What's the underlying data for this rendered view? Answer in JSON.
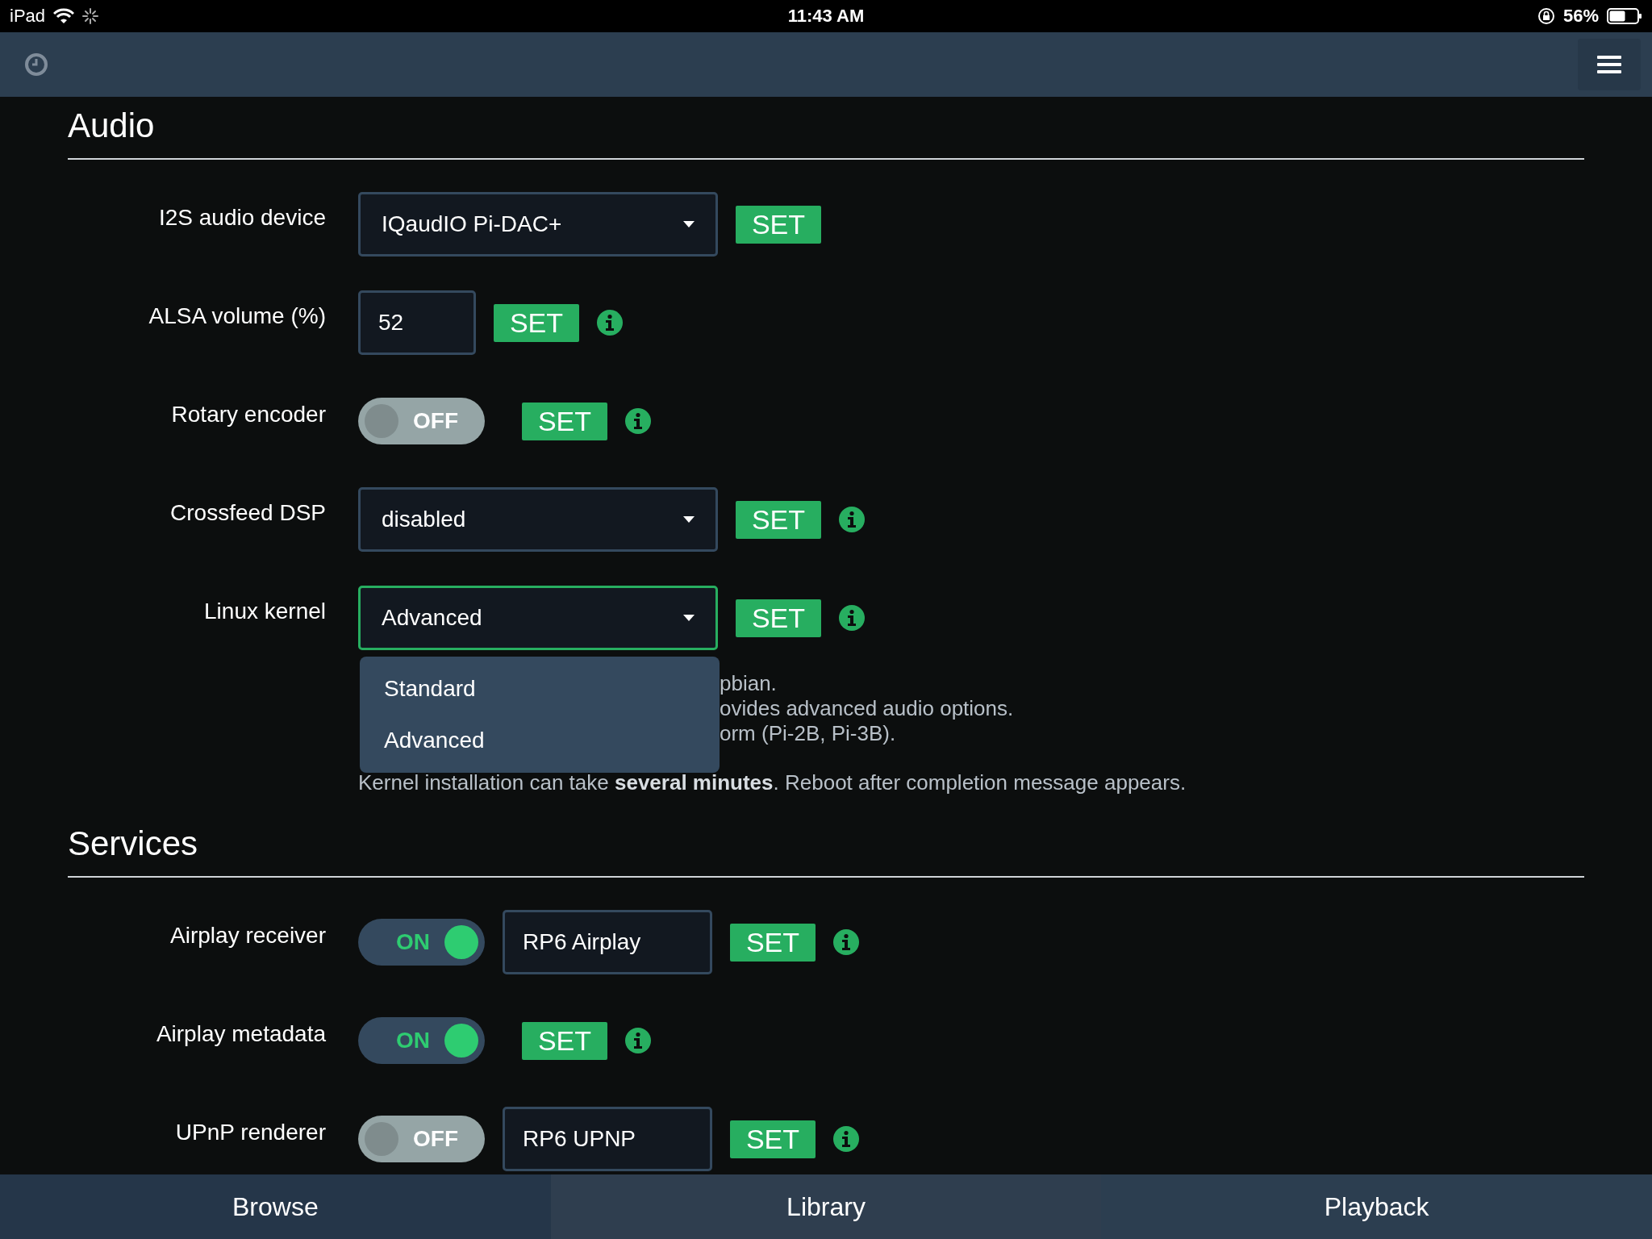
{
  "status_bar": {
    "device": "iPad",
    "time": "11:43 AM",
    "battery": "56%"
  },
  "sections": [
    {
      "title": "Audio",
      "rows": [
        {
          "label": "I2S audio device",
          "kind": "select",
          "value": "IQaudIO Pi-DAC+",
          "focused": false,
          "button": "SET",
          "info": false
        },
        {
          "label": "ALSA volume (%)",
          "kind": "number",
          "value": "52",
          "button": "SET",
          "info": true
        },
        {
          "label": "Rotary encoder",
          "kind": "toggle",
          "on": false,
          "on_text": "OFF",
          "button": "SET",
          "info": true
        },
        {
          "label": "Crossfeed DSP",
          "kind": "select",
          "value": "disabled",
          "focused": false,
          "button": "SET",
          "info": true
        },
        {
          "label": "Linux kernel",
          "kind": "select",
          "value": "Advanced",
          "focused": true,
          "button": "SET",
          "info": true,
          "expanded": true,
          "options": [
            {
              "label": "Standard"
            },
            {
              "label": "Advanced"
            }
          ],
          "help_fragments": [
            "pbian.",
            "ovides advanced audio options.",
            "orm (Pi-2B, Pi-3B)."
          ],
          "note": "Kernel installation can take **several minutes**. Reboot after completion message appears."
        }
      ]
    },
    {
      "title": "Services",
      "rows": [
        {
          "label": "Airplay receiver",
          "kind": "toggle",
          "on": true,
          "on_text": "ON",
          "name": "RP6 Airplay",
          "button": "SET",
          "info": true
        },
        {
          "label": "Airplay metadata",
          "kind": "toggle",
          "on": true,
          "on_text": "ON",
          "button": "SET",
          "info": true
        },
        {
          "label": "UPnP renderer",
          "kind": "toggle",
          "on": false,
          "on_text": "OFF",
          "name": "RP6 UPNP",
          "button": "SET",
          "info": true
        }
      ]
    }
  ],
  "nav_tabs": [
    {
      "label": "Browse"
    },
    {
      "label": "Library"
    },
    {
      "label": "Playback"
    }
  ]
}
